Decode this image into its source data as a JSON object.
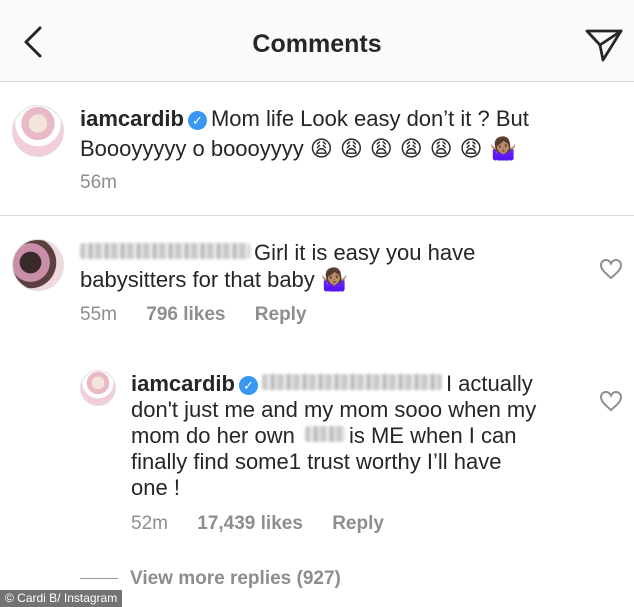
{
  "header": {
    "title": "Comments",
    "back_icon": "chevron-left-icon",
    "send_icon": "paper-plane-icon"
  },
  "caption": {
    "username": "iamcardib",
    "verified": true,
    "text_line1": "Mom life Look easy don’t it ? But",
    "text_line2": "Boooyyyyy o boooyyyy",
    "emojis": "😩 😩 😩 😩 😩 😩 🤷🏽‍♀️",
    "time": "56m"
  },
  "comment": {
    "username_redacted": true,
    "text_line1": "Girl it is easy you have",
    "text_line2": "babysitters for that baby",
    "emoji": "🤷🏽‍♀️",
    "time": "55m",
    "likes": "796 likes",
    "reply_label": "Reply"
  },
  "reply": {
    "username": "iamcardib",
    "verified": true,
    "mention_redacted": true,
    "text_line1": "I actually",
    "text_line2": "don't just me and my mom sooo when my",
    "text_line3a": "mom do her own",
    "text_line3b": "is ME when I can",
    "text_line4": "finally find some1 trust worthy I’ll have",
    "text_line5": "one !",
    "time": "52m",
    "likes": "17,439 likes",
    "reply_label": "Reply"
  },
  "view_more": "View more replies (927)",
  "credit": "© Cardi B/ Instagram",
  "colors": {
    "text": "#262626",
    "muted": "#8e8e8e",
    "verified": "#3897f0",
    "divider": "#dbdbdb"
  }
}
